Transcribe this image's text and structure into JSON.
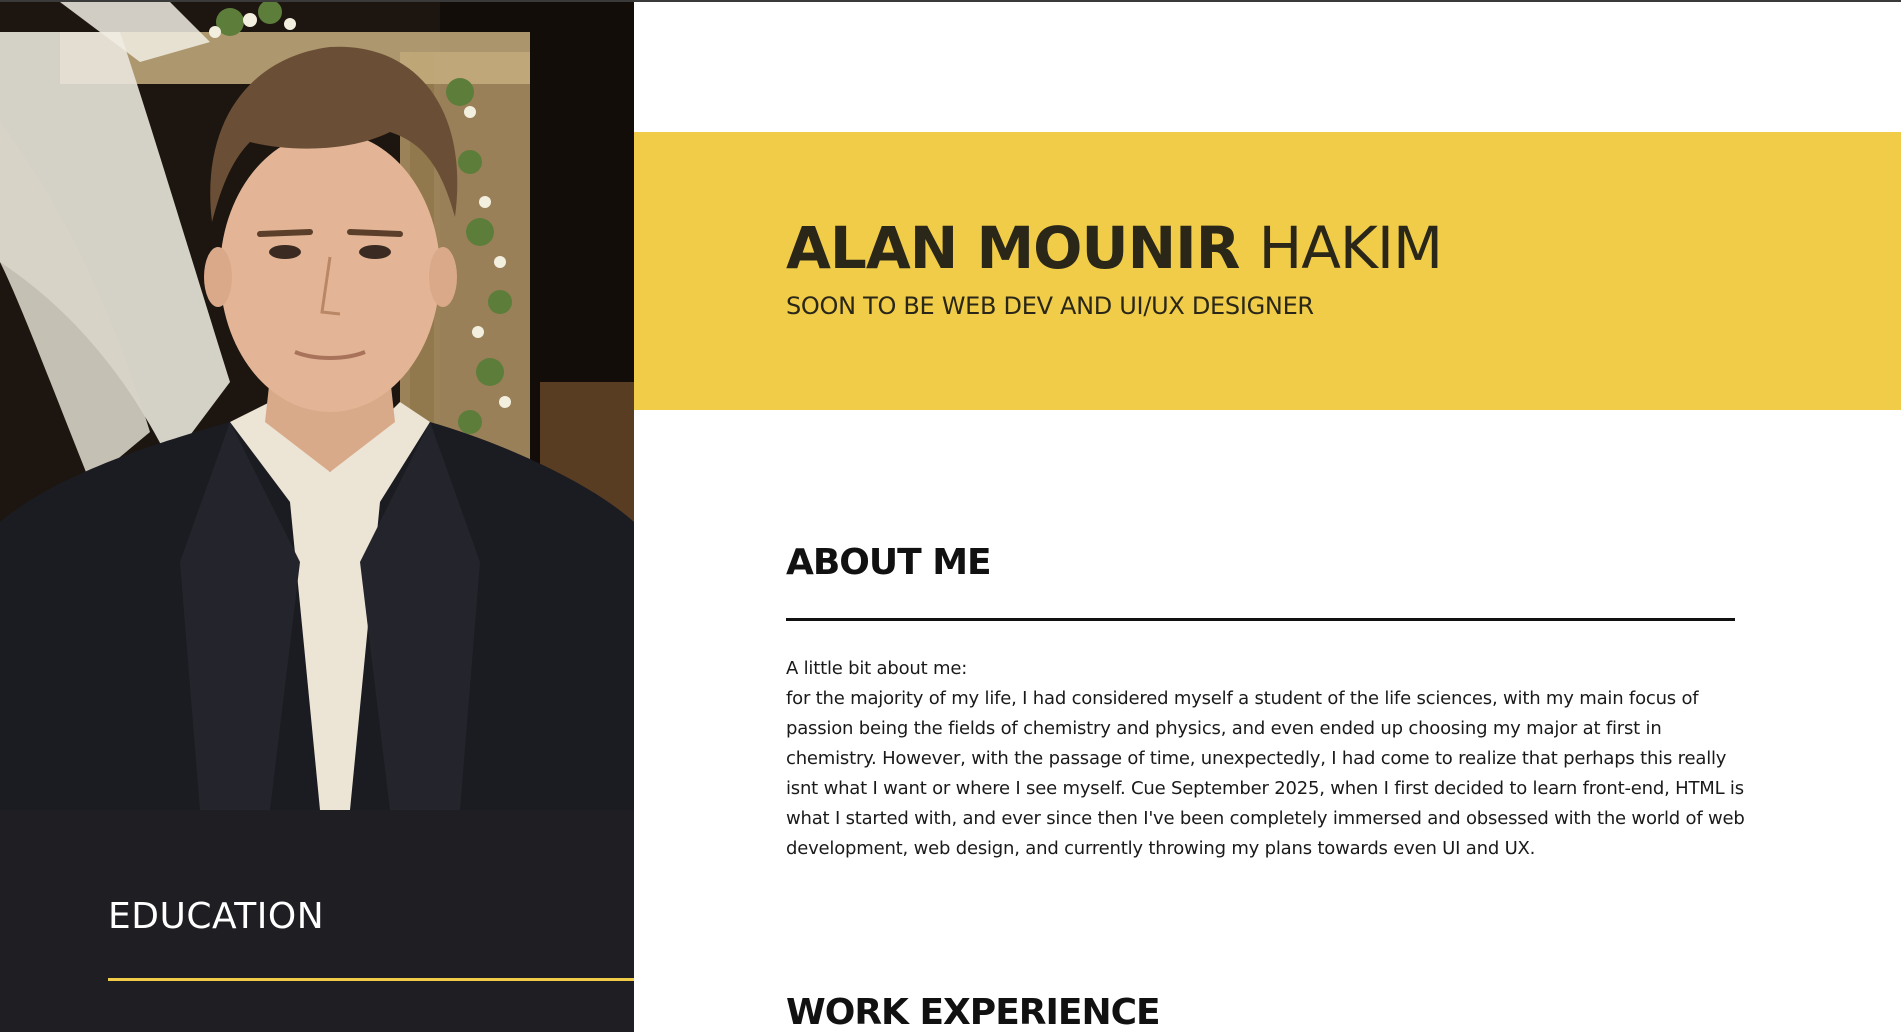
{
  "profile": {
    "first_name": "ALAN MOUNIR",
    "last_name": "HAKIM",
    "tagline": "SOON TO BE WEB DEV AND UI/UX DESIGNER",
    "photo_alt": "Portrait photo"
  },
  "about": {
    "title": "ABOUT ME",
    "intro": "A little bit about me:",
    "body": "for the majority of my life, I had considered myself a student of the life sciences, with my main focus of passion being the fields of chemistry and physics, and even ended up choosing my major at first in chemistry. However, with the passage of time, unexpectedly, I had come to realize that perhaps this really isnt what I want or where I see myself. Cue September 2025, when I first decided to learn front-end, HTML is what I started with, and ever since then I've been completely immersed and obsessed with the world of web development, web design, and currently throwing my plans towards even UI and UX."
  },
  "education": {
    "title": "EDUCATION"
  },
  "work": {
    "title": "WORK EXPERIENCE"
  },
  "colors": {
    "accent": "#f0cc48",
    "dark_panel": "#1f1e23",
    "text_dark": "#2a2718"
  }
}
